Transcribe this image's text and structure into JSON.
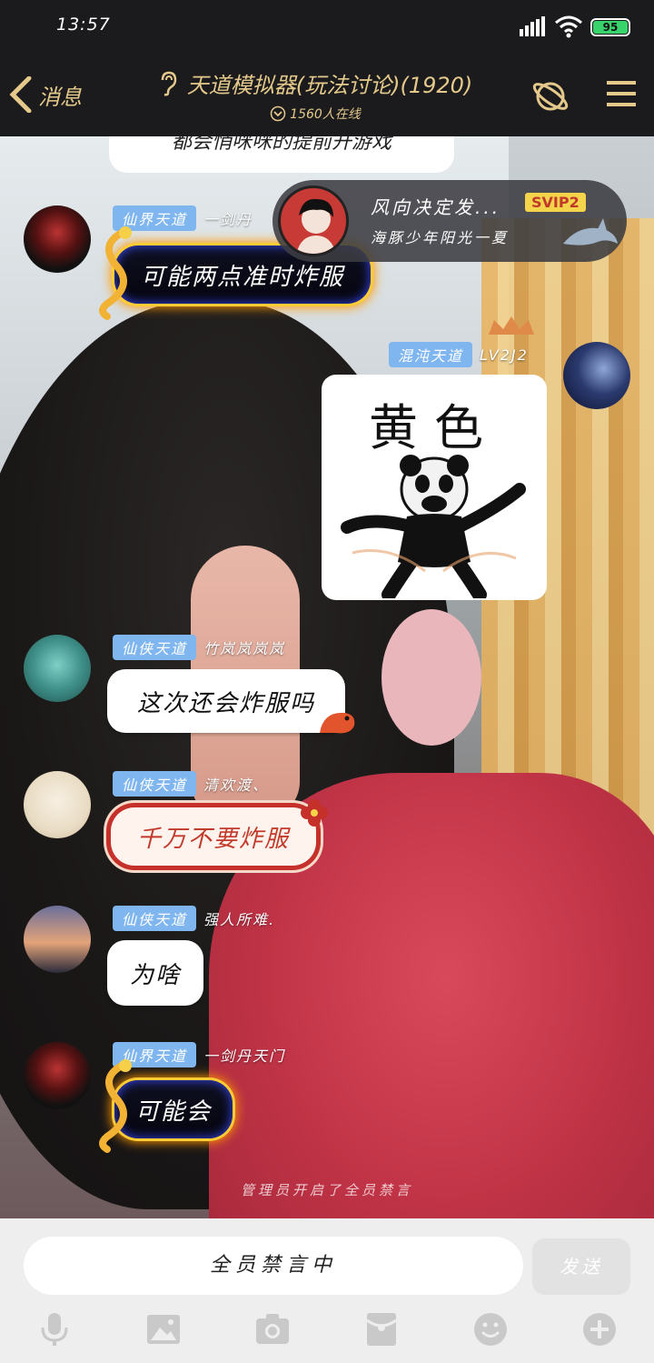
{
  "status_bar": {
    "time": "13:57",
    "battery": "95"
  },
  "header": {
    "back_label": "消息",
    "title": "天道模拟器(玩法讨论)(1920)",
    "online": "1560人在线"
  },
  "partial_message": "都会悄咪咪的提前开游戏",
  "banner": {
    "title": "风向决定发...",
    "badge": "SVIP2",
    "subtitle": "海豚少年阳光一夏"
  },
  "messages": [
    {
      "tag": "仙界天道",
      "nick": "一剑丹",
      "text": "可能两点准时炸服"
    },
    {
      "tag": "混沌天道",
      "nick": "LV2J2",
      "sticker_text": "黄色"
    },
    {
      "tag": "仙侠天道",
      "nick": "竹岚岚岚岚",
      "text": "这次还会炸服吗"
    },
    {
      "tag": "仙侠天道",
      "nick": "清欢渡、",
      "text": "千万不要炸服"
    },
    {
      "tag": "仙侠天道",
      "nick": "强人所难.",
      "text": "为啥"
    },
    {
      "tag": "仙界天道",
      "nick": "一剑丹天门",
      "text": "可能会"
    }
  ],
  "system_notice": "管理员开启了全员禁言",
  "input": {
    "placeholder": "全员禁言中",
    "send_label": "发送"
  },
  "colors": {
    "header_bg": "#1b1b1d",
    "header_gold": "#e4c98b",
    "tag_blue": "#7fb6f0",
    "battery_green": "#38d36a"
  },
  "toolbar_icons": [
    "microphone-icon",
    "image-icon",
    "camera-icon",
    "red-packet-icon",
    "emoji-icon",
    "plus-icon"
  ]
}
